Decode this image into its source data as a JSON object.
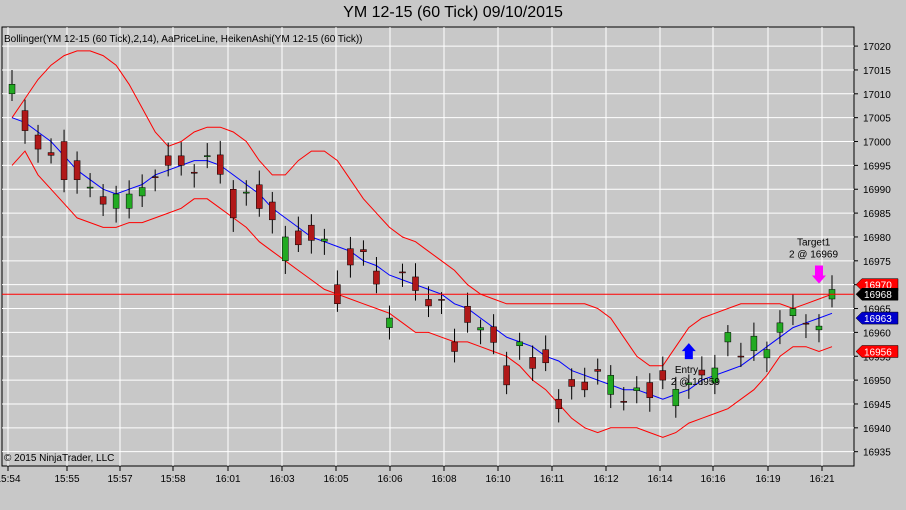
{
  "title": "YM 12-15 (60 Tick)  09/10/2015",
  "indicator_label": "Bollinger(YM 12-15 (60 Tick),2,14), AaPriceLine, HeikenAshi(YM 12-15 (60 Tick))",
  "copyright": "© 2015 NinjaTrader, LLC",
  "colors": {
    "background": "#c8c8c8",
    "up_candle": "#22aa22",
    "down_candle": "#b01818",
    "bollinger_band": "#ff0000",
    "bollinger_mid": "#0000ff",
    "price_line": "#ff0000",
    "target_marker": "#ff00ff",
    "entry_marker": "#0000ff"
  },
  "chart_data": {
    "type": "candlestick",
    "title": "YM 12-15 (60 Tick)  09/10/2015",
    "ylim": [
      16932,
      17024
    ],
    "y_ticks": [
      17020,
      17015,
      17010,
      17005,
      17000,
      16995,
      16990,
      16985,
      16980,
      16975,
      16970,
      16965,
      16960,
      16955,
      16950,
      16945,
      16940,
      16935
    ],
    "x_ticks": [
      "15:54",
      "15:55",
      "15:57",
      "15:58",
      "16:01",
      "16:03",
      "16:05",
      "16:06",
      "16:08",
      "16:10",
      "16:11",
      "16:12",
      "16:14",
      "16:16",
      "16:19",
      "16:21"
    ],
    "grid": true,
    "series": [
      {
        "name": "Upper band",
        "values": [
          17005,
          17009,
          17013,
          17016,
          17018,
          17019,
          17019,
          17018,
          17016,
          17012,
          17007,
          17002,
          16999,
          17000,
          17002,
          17003,
          17003,
          17002,
          17000,
          16996,
          16993,
          16993,
          16996,
          16998,
          16998,
          16996,
          16992,
          16988,
          16985,
          16982,
          16980,
          16979,
          16977,
          16975,
          16973,
          16970,
          16968,
          16967,
          16966,
          16966,
          16966,
          16966,
          16966,
          16966,
          16966,
          16965,
          16963,
          16959,
          16955,
          16953,
          16953,
          16957,
          16961,
          16963,
          16964,
          16965,
          16966,
          16966,
          16966,
          16966,
          16965,
          16966,
          16967,
          16968
        ]
      },
      {
        "name": "Lower band",
        "values": [
          16995,
          16998,
          16993,
          16990,
          16987,
          16984,
          16983,
          16982,
          16982,
          16983,
          16983,
          16984,
          16985,
          16986,
          16988,
          16988,
          16986,
          16984,
          16982,
          16979,
          16977,
          16975,
          16973,
          16971,
          16969,
          16968,
          16967,
          16966,
          16965,
          16964,
          16962,
          16960,
          16960,
          16959,
          16958,
          16958,
          16957,
          16956,
          16955,
          16953,
          16950,
          16948,
          16945,
          16942,
          16940,
          16939,
          16940,
          16940,
          16940,
          16939,
          16938,
          16939,
          16941,
          16942,
          16943,
          16944,
          16946,
          16948,
          16951,
          16955,
          16957,
          16957,
          16956,
          16957
        ]
      },
      {
        "name": "Middle band",
        "values": [
          17005,
          17004,
          17002,
          17000,
          16997,
          16994,
          16992,
          16990,
          16989,
          16990,
          16991,
          16993,
          16994,
          16995,
          16996,
          16996,
          16995,
          16993,
          16991,
          16989,
          16986,
          16984,
          16982,
          16980,
          16979,
          16978,
          16977,
          16975,
          16974,
          16972,
          16971,
          16970,
          16969,
          16968,
          16966,
          16965,
          16963,
          16961,
          16959,
          16958,
          16957,
          16955,
          16954,
          16952,
          16951,
          16950,
          16949,
          16948,
          16948,
          16947,
          16946,
          16947,
          16948,
          16950,
          16951,
          16952,
          16953,
          16955,
          16957,
          16959,
          16961,
          16962,
          16963,
          16964
        ]
      },
      {
        "name": "Last price",
        "values": [
          16968
        ]
      }
    ],
    "candles_summary": [
      {
        "time": "15:54",
        "open": 17010,
        "close": 17012
      },
      {
        "time": "15:55",
        "open": 17000,
        "close": 16992
      },
      {
        "time": "15:57",
        "open": 16986,
        "close": 16989
      },
      {
        "time": "15:58",
        "open": 16997,
        "close": 16995
      },
      {
        "time": "16:01",
        "open": 16990,
        "close": 16984
      },
      {
        "time": "16:03",
        "open": 16975,
        "close": 16980
      },
      {
        "time": "16:05",
        "open": 16970,
        "close": 16966
      },
      {
        "time": "16:06",
        "open": 16961,
        "close": 16963
      },
      {
        "time": "16:08",
        "open": 16958,
        "close": 16956
      },
      {
        "time": "16:10",
        "open": 16953,
        "close": 16949
      },
      {
        "time": "16:11",
        "open": 16946,
        "close": 16944
      },
      {
        "time": "16:12",
        "open": 16947,
        "close": 16951
      },
      {
        "time": "16:14",
        "open": 16952,
        "close": 16950
      },
      {
        "time": "16:16",
        "open": 16958,
        "close": 16960
      },
      {
        "time": "16:19",
        "open": 16960,
        "close": 16962
      },
      {
        "time": "16:21",
        "open": 16967,
        "close": 16969
      }
    ],
    "price_tags": [
      {
        "value": 16970,
        "label": "16970",
        "color": "#ff0000"
      },
      {
        "value": 16968,
        "label": "16968",
        "color": "#000000"
      },
      {
        "value": 16963,
        "label": "16963",
        "color": "#0000cc"
      },
      {
        "value": 16956,
        "label": "16956",
        "color": "#ff0000"
      }
    ],
    "annotations": [
      {
        "text": "Target1",
        "line2": "2 @ 16969",
        "x_index": 62,
        "price": 16969
      },
      {
        "text": "Entry",
        "line2": "2 @ 16959",
        "x_index": 52,
        "price": 16959
      }
    ]
  }
}
